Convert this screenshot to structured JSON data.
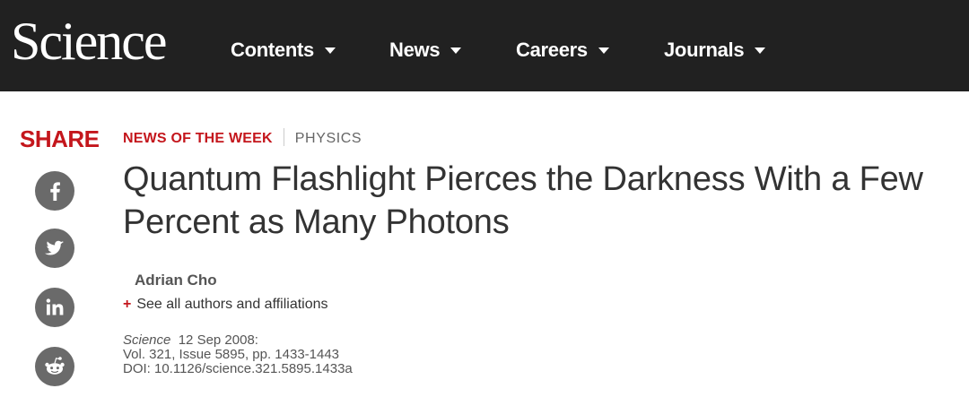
{
  "header": {
    "logo": "Science",
    "nav": [
      {
        "label": "Contents"
      },
      {
        "label": "News"
      },
      {
        "label": "Careers"
      },
      {
        "label": "Journals"
      }
    ]
  },
  "share": {
    "label": "SHARE",
    "buttons": [
      {
        "icon": "facebook-icon"
      },
      {
        "icon": "twitter-icon"
      },
      {
        "icon": "linkedin-icon"
      },
      {
        "icon": "reddit-icon"
      }
    ]
  },
  "article": {
    "section": "NEWS OF THE WEEK",
    "topic": "PHYSICS",
    "title": "Quantum Flashlight Pierces the Darkness With a Few Percent as Many Photons",
    "author": "Adrian Cho",
    "affiliations_plus": "+",
    "affiliations_link": "See all authors and affiliations",
    "citation": {
      "journal": "Science",
      "date": "12 Sep 2008:",
      "volume": "Vol. 321, Issue 5895, pp. 1433-1443",
      "doi": "DOI: 10.1126/science.321.5895.1433a"
    }
  },
  "colors": {
    "header_bg": "#212121",
    "accent_red": "#c4161c",
    "icon_gray": "#6a6a6a"
  }
}
